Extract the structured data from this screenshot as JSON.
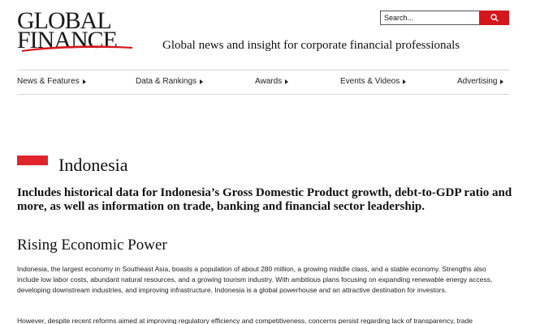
{
  "logo": {
    "line1": "GLOBAL",
    "line2": "FINANCE"
  },
  "search": {
    "placeholder": "Search..."
  },
  "tagline": "Global news and insight for corporate financial professionals",
  "nav": {
    "items": [
      {
        "label": "News & Features"
      },
      {
        "label": "Data & Rankings"
      },
      {
        "label": "Awards"
      },
      {
        "label": "Events & Videos"
      },
      {
        "label": "Advertising"
      }
    ]
  },
  "page": {
    "country": "Indonesia",
    "flag_colors": {
      "top": "#e0242b",
      "bottom": "#ffffff"
    },
    "intro": "Includes historical data for Indonesia’s Gross Domestic Product growth, debt-to-GDP ratio and more, as well as information on trade, banking and financial sector leadership.",
    "section_title": "Rising Economic Power",
    "paragraph1": "Indonesia, the largest economy in Southeast Asia, boasts a population of about 280 million, a growing middle class, and a stable economy. Strengths also include low labor costs, abundant natural resources, and a growing tourism industry. With ambitious plans focusing on expanding renewable energy access, developing downstream industries, and improving infrastructure, Indonesia is a global powerhouse and an attractive destination for investors.",
    "paragraph2": "However, despite recent reforms aimed at improving regulatory efficiency and competitiveness, concerns persist regarding lack of transparency, trade"
  },
  "colors": {
    "accent": "#d3161c",
    "text": "#111111",
    "rule": "#d6d6d6"
  }
}
